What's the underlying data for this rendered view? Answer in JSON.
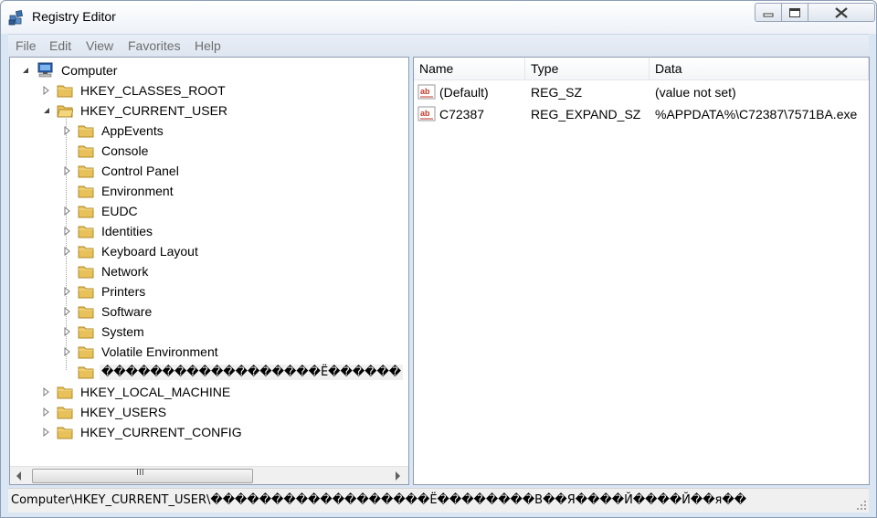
{
  "window": {
    "title": "Registry Editor"
  },
  "menu": [
    "File",
    "Edit",
    "View",
    "Favorites",
    "Help"
  ],
  "tree": {
    "root": "Computer",
    "hives": [
      "HKEY_CLASSES_ROOT",
      "HKEY_CURRENT_USER",
      "HKEY_LOCAL_MACHINE",
      "HKEY_USERS",
      "HKEY_CURRENT_CONFIG"
    ],
    "hkcu_children": [
      "AppEvents",
      "Console",
      "Control Panel",
      "Environment",
      "EUDC",
      "Identities",
      "Keyboard Layout",
      "Network",
      "Printers",
      "Software",
      "System",
      "Volatile Environment",
      "������������������Ё������"
    ]
  },
  "columns": {
    "name": "Name",
    "type": "Type",
    "data": "Data"
  },
  "values": [
    {
      "name": "(Default)",
      "type": "REG_SZ",
      "data": "(value not set)"
    },
    {
      "name": "C72387",
      "type": "REG_EXPAND_SZ",
      "data": "%APPDATA%\\C72387\\7571BA.exe"
    }
  ],
  "status": {
    "path": "Computer\\HKEY_CURRENT_USER\\������������������Ё��������В��Я����Й����Й��я��"
  },
  "scroll": {
    "thumb_label": "III"
  },
  "colors": {
    "folder": "#e8c15a",
    "frame": "#dae6f4",
    "selection": "#f0f0f0"
  }
}
